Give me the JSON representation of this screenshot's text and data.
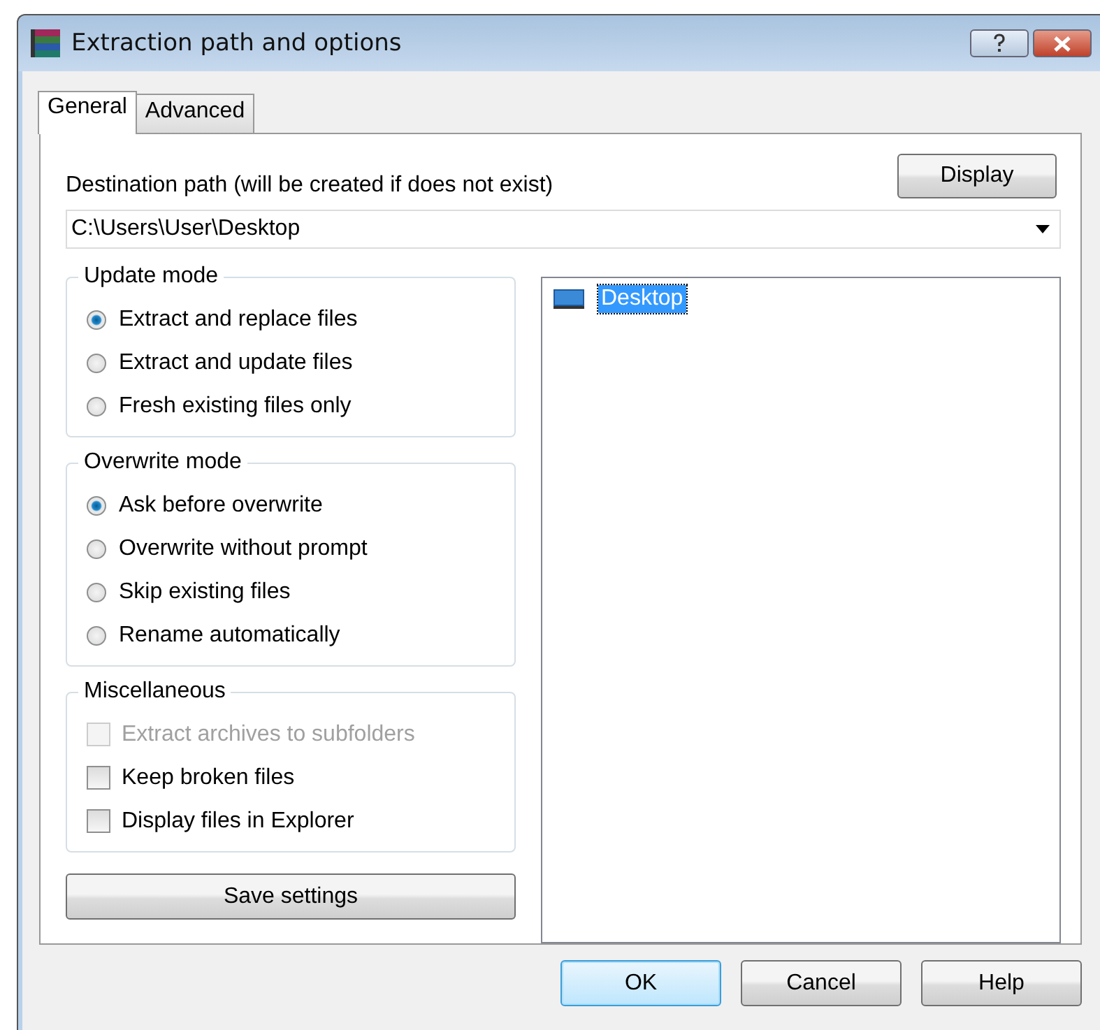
{
  "window": {
    "title": "Extraction path and options"
  },
  "tabs": [
    {
      "label": "General",
      "selected": true
    },
    {
      "label": "Advanced",
      "selected": false
    }
  ],
  "destination": {
    "label": "Destination path (will be created if does not exist)",
    "value": "C:\\Users\\User\\Desktop",
    "display_button": "Display"
  },
  "groups": [
    {
      "title": "Update mode",
      "kind": "radio",
      "items": [
        {
          "label": "Extract and replace files",
          "selected": true
        },
        {
          "label": "Extract and update files",
          "selected": false
        },
        {
          "label": "Fresh existing files only",
          "selected": false
        }
      ]
    },
    {
      "title": "Overwrite mode",
      "kind": "radio",
      "items": [
        {
          "label": "Ask before overwrite",
          "selected": true
        },
        {
          "label": "Overwrite without prompt",
          "selected": false
        },
        {
          "label": "Skip existing files",
          "selected": false
        },
        {
          "label": "Rename automatically",
          "selected": false
        }
      ]
    },
    {
      "title": "Miscellaneous",
      "kind": "checkbox",
      "items": [
        {
          "label": "Extract archives to subfolders",
          "checked": false,
          "disabled": true
        },
        {
          "label": "Keep broken files",
          "checked": false,
          "disabled": false
        },
        {
          "label": "Display files in Explorer",
          "checked": false,
          "disabled": false
        }
      ]
    }
  ],
  "save_button": "Save settings",
  "folder_tree": [
    {
      "label": "Desktop",
      "selected": true
    }
  ],
  "buttons": [
    {
      "label": "OK",
      "default": true
    },
    {
      "label": "Cancel",
      "default": false
    },
    {
      "label": "Help",
      "default": false
    }
  ]
}
